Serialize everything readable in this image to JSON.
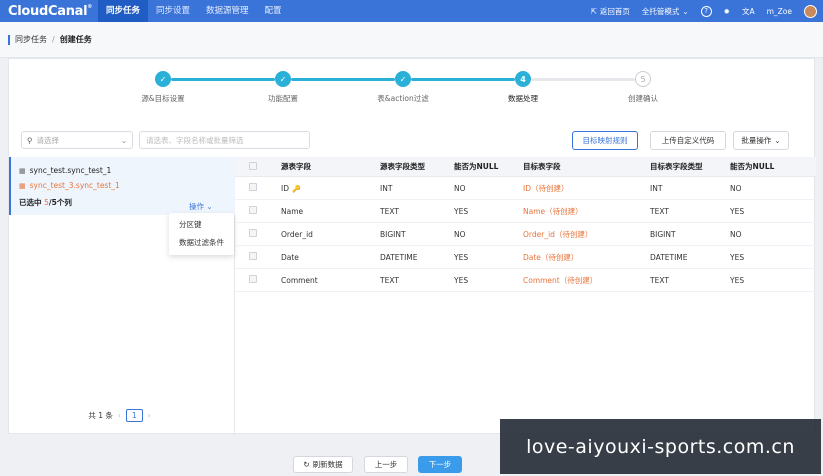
{
  "app": {
    "logo": "CloudCanal"
  },
  "nav": {
    "tabs": [
      "同步任务",
      "同步设置",
      "数据源管理",
      "配置"
    ],
    "active_index": 0,
    "home": "返回首页",
    "mode": "全托管模式",
    "user": "m_Zoe"
  },
  "breadcrumb": {
    "parent": "同步任务",
    "sep": "/",
    "current": "创建任务"
  },
  "steps": [
    {
      "label": "源&目标设置",
      "status": "done",
      "marker": "✓"
    },
    {
      "label": "功能配置",
      "status": "done",
      "marker": "✓"
    },
    {
      "label": "表&action过滤",
      "status": "done",
      "marker": "✓"
    },
    {
      "label": "数据处理",
      "status": "current",
      "marker": "4"
    },
    {
      "label": "创建确认",
      "status": "todo",
      "marker": "5"
    }
  ],
  "toolbar": {
    "select_placeholder": "请选择",
    "search_placeholder": "请选表、字段名称或批量筛选",
    "mapping_rule": "目标映射规则",
    "upload_code": "上传自定义代码",
    "batch_ops": "批量操作"
  },
  "table_list": {
    "source_table": "sync_test.sync_test_1",
    "target_table": "sync_test_3.sync_test_1",
    "selected_prefix": "已选中",
    "selected_count": "5",
    "selected_suffix": "/5个列",
    "op_label": "操作",
    "menu": [
      "分区键",
      "数据过滤条件"
    ],
    "pager_total": "共 1 条",
    "pager_page": "1"
  },
  "columns_table": {
    "headers": [
      "源表字段",
      "源表字段类型",
      "能否为NULL",
      "目标表字段",
      "目标表字段类型",
      "能否为NULL"
    ],
    "rows": [
      {
        "src": "ID",
        "src_type": "INT",
        "src_null": "NO",
        "tgt": "ID（待创建）",
        "tgt_type": "INT",
        "tgt_null": "NO",
        "key": true
      },
      {
        "src": "Name",
        "src_type": "TEXT",
        "src_null": "YES",
        "tgt": "Name（待创建）",
        "tgt_type": "TEXT",
        "tgt_null": "YES",
        "key": false
      },
      {
        "src": "Order_id",
        "src_type": "BIGINT",
        "src_null": "NO",
        "tgt": "Order_id（待创建）",
        "tgt_type": "BIGINT",
        "tgt_null": "NO",
        "key": false
      },
      {
        "src": "Date",
        "src_type": "DATETIME",
        "src_null": "YES",
        "tgt": "Date（待创建）",
        "tgt_type": "DATETIME",
        "tgt_null": "YES",
        "key": false
      },
      {
        "src": "Comment",
        "src_type": "TEXT",
        "src_null": "YES",
        "tgt": "Comment（待创建）",
        "tgt_type": "TEXT",
        "tgt_null": "YES",
        "key": false
      }
    ]
  },
  "footer": {
    "refresh": "刷新数据",
    "prev": "上一步",
    "next": "下一步"
  },
  "watermark": "love-aiyouxi-sports.com.cn",
  "colors": {
    "nav": "#3a74d8",
    "step": "#2bb0d8",
    "target_text": "#e8743b",
    "primary": "#3a9bea"
  }
}
